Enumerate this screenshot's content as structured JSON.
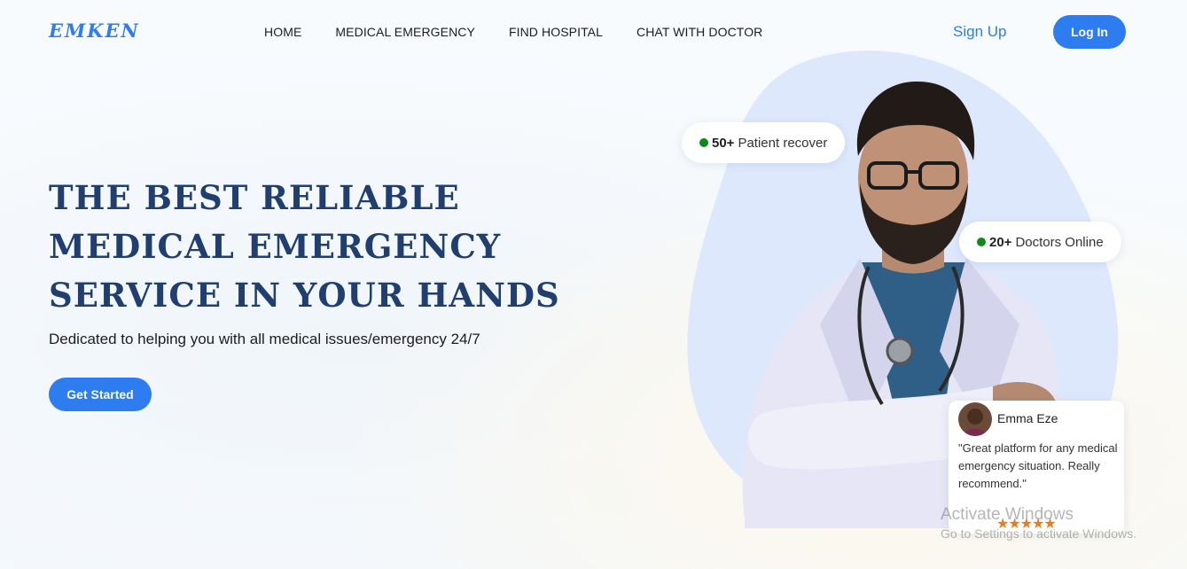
{
  "header": {
    "logo": "EMKEN",
    "nav": [
      "HOME",
      "MEDICAL EMERGENCY",
      "FIND HOSPITAL",
      "CHAT WITH DOCTOR"
    ],
    "signup_label": "Sign Up",
    "login_label": "Log In"
  },
  "hero": {
    "title": "THE BEST RELIABLE MEDICAL EMERGENCY SERVICE IN YOUR HANDS",
    "subtitle": "Dedicated to helping you with all medical issues/emergency 24/7",
    "cta_label": "Get Started"
  },
  "stats": [
    {
      "value": "50+",
      "label": "Patient recover"
    },
    {
      "value": "20+",
      "label": "Doctors Online"
    }
  ],
  "review": {
    "name": "Emma Eze",
    "quote": "\"Great platform for any medical emergency situation. Really recommend.\"",
    "rating": 5,
    "stars": "★★★★★"
  },
  "watermark": {
    "line1": "Activate Windows",
    "line2": "Go to Settings to activate Windows."
  },
  "colors": {
    "accent": "#2d7cf0",
    "title": "#203f6e",
    "status_dot": "#0d8a1a",
    "star": "#f07a1a"
  }
}
